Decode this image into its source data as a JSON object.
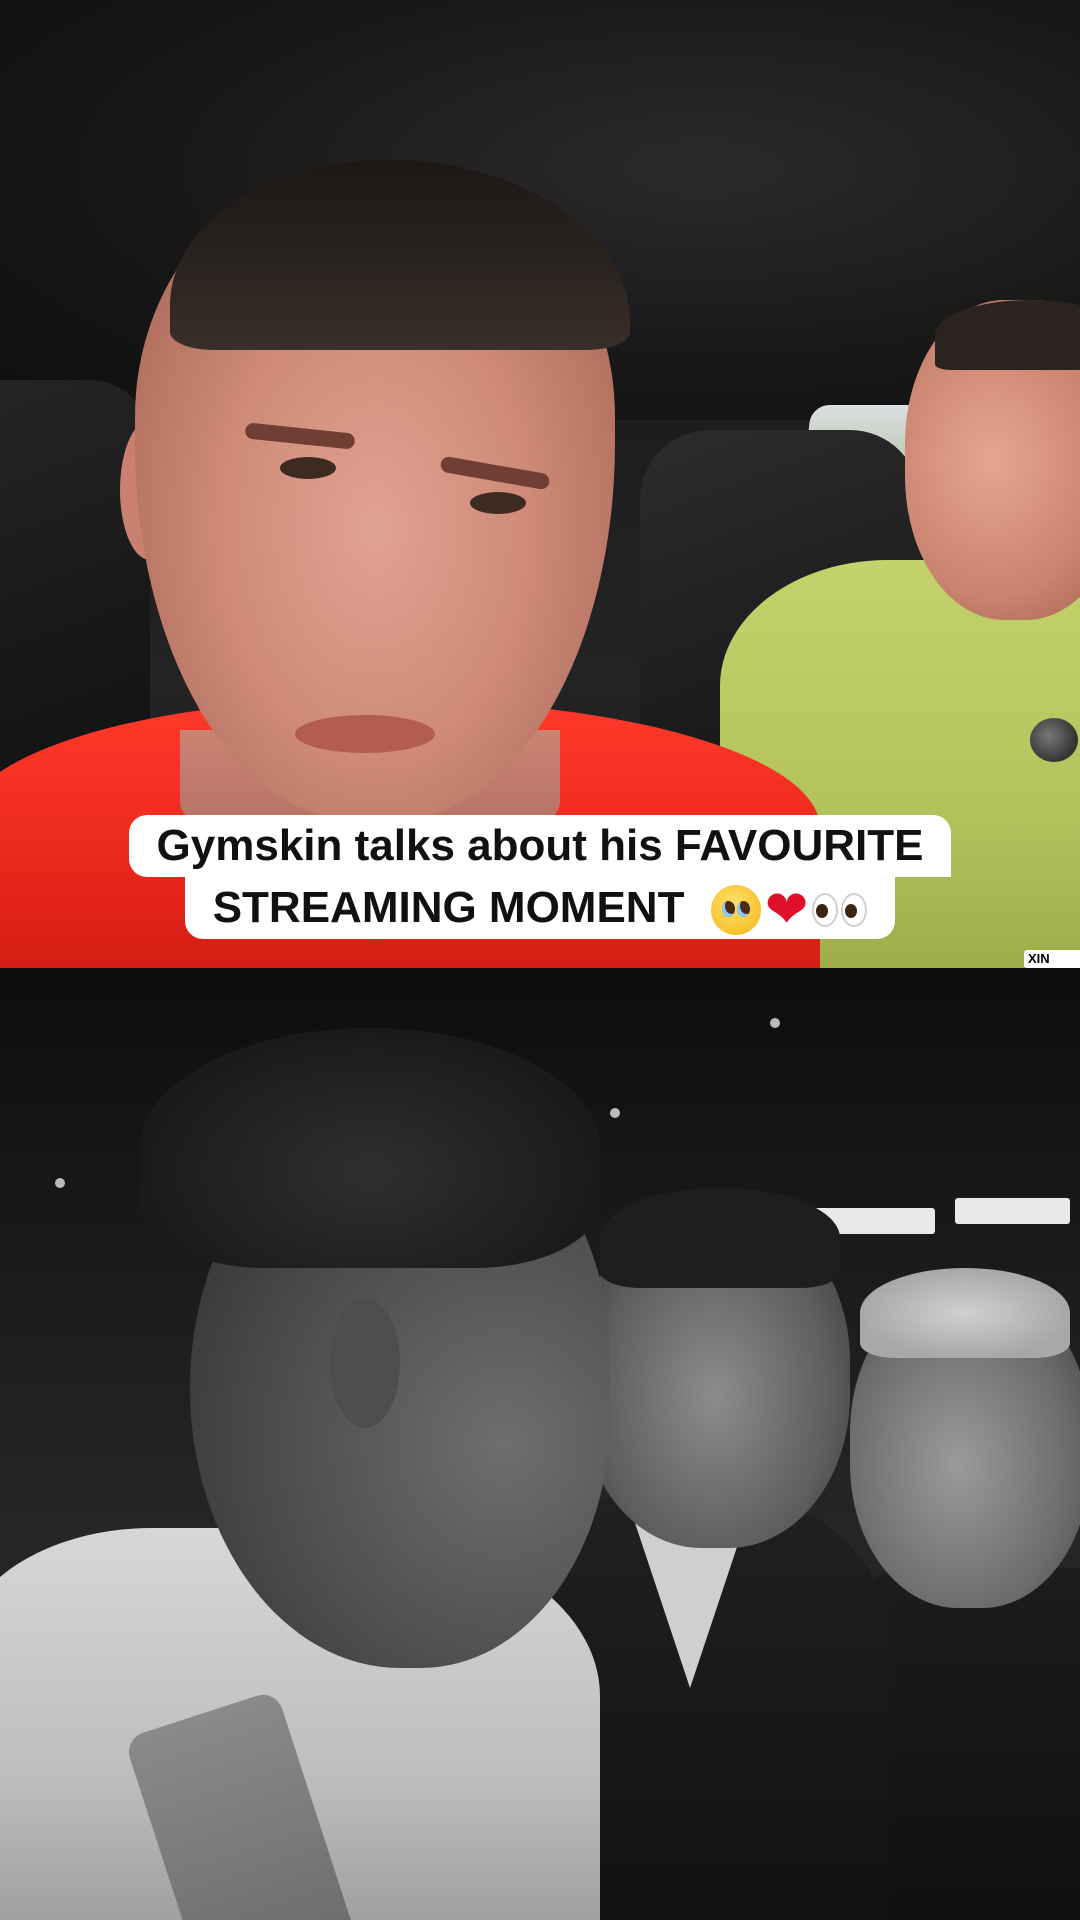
{
  "caption": {
    "line1": "Gymskin talks about his FAVOURITE",
    "line2": "STREAMING MOMENT"
  },
  "caption_emojis": [
    "pleading-face-icon",
    "red-heart-icon",
    "eyes-icon"
  ],
  "watermark": "XIN",
  "colors": {
    "caption_bg": "#ffffff",
    "caption_text": "#111111",
    "shirt_red": "#e52419",
    "shirt_lime": "#b3c25b"
  }
}
